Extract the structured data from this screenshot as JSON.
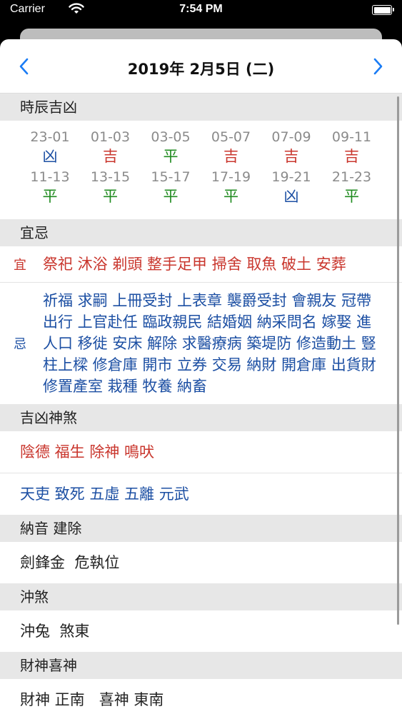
{
  "status_bar": {
    "carrier": "Carrier",
    "time": "7:54 PM",
    "battery_level": 1.0
  },
  "nav": {
    "title": "2019年 2月5日 (二)",
    "prev_icon": "chevron-left-icon",
    "next_icon": "chevron-right-icon"
  },
  "sections": {
    "hours": "時辰吉凶",
    "yiji": "宜忌",
    "shensha": "吉凶神煞",
    "nayin": "納音 建除",
    "chongsha": "沖煞",
    "caishen": "財神喜神"
  },
  "hours": [
    {
      "range": "23-01",
      "luck": "凶"
    },
    {
      "range": "01-03",
      "luck": "吉"
    },
    {
      "range": "03-05",
      "luck": "平"
    },
    {
      "range": "05-07",
      "luck": "吉"
    },
    {
      "range": "07-09",
      "luck": "吉"
    },
    {
      "range": "09-11",
      "luck": "吉"
    },
    {
      "range": "11-13",
      "luck": "平"
    },
    {
      "range": "13-15",
      "luck": "平"
    },
    {
      "range": "15-17",
      "luck": "平"
    },
    {
      "range": "17-19",
      "luck": "平"
    },
    {
      "range": "19-21",
      "luck": "凶"
    },
    {
      "range": "21-23",
      "luck": "平"
    }
  ],
  "luck_colors": {
    "吉": "#c9362d",
    "凶": "#1c4fa3",
    "平": "#1f8b1f"
  },
  "yi": {
    "tag": "宜",
    "words": "祭祀 沐浴 剃頭 整手足甲 掃舍 取魚 破土 安葬"
  },
  "ji": {
    "tag": "忌",
    "words": "祈福 求嗣 上冊受封 上表章 襲爵受封 會親友 冠帶 出行 上官赴任 臨政親民 結婚姻 納采問名 嫁娶 進人口 移徙 安床 解除 求醫療病 築堤防 修造動土 豎柱上樑 修倉庫 開市 立券 交易 納財 開倉庫 出貨財 修置產室 栽種 牧養 納畜"
  },
  "shensha": {
    "good": "陰德 福生 除神 鳴吠",
    "bad": "天吏 致死 五虛 五離 元武"
  },
  "nayin": {
    "text": "劍鋒金  危執位"
  },
  "chongsha": {
    "text": "沖兔  煞東"
  },
  "caishen": {
    "text": "財神 正南   喜神 東南"
  }
}
